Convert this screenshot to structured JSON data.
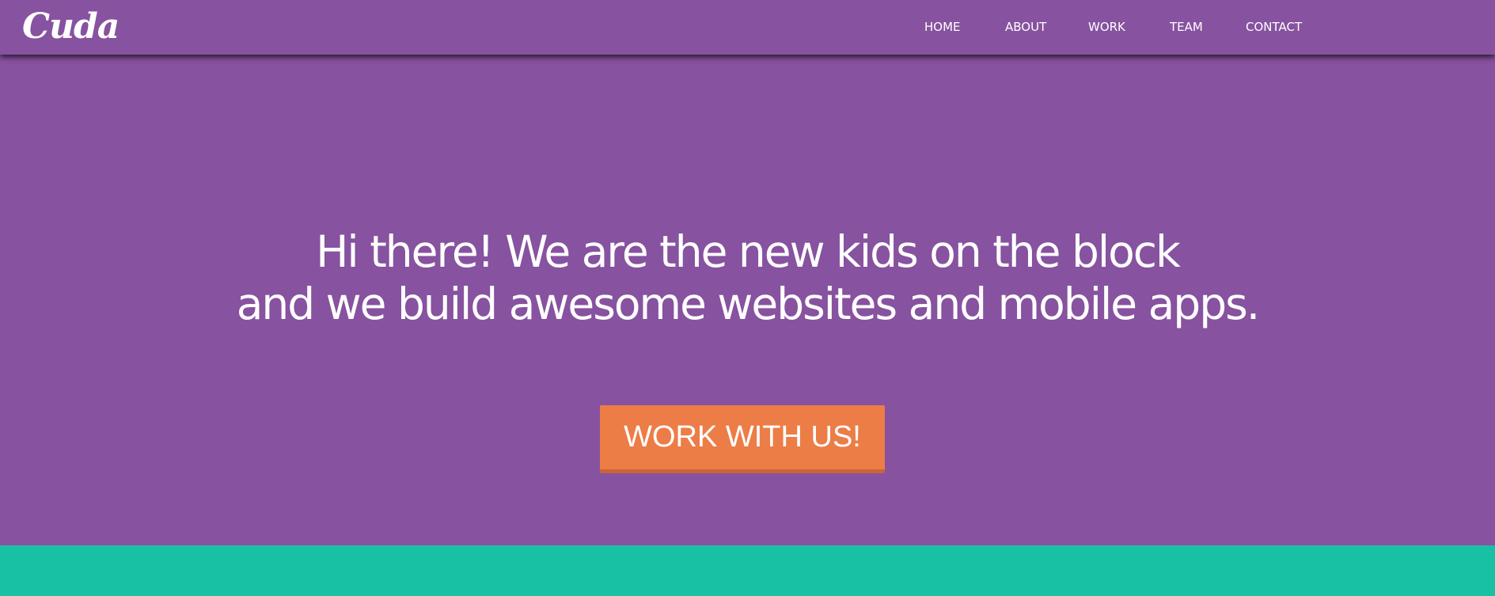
{
  "brand": {
    "logo_text": "Cuda"
  },
  "nav": {
    "items": [
      {
        "label": "HOME"
      },
      {
        "label": "ABOUT"
      },
      {
        "label": "WORK"
      },
      {
        "label": "TEAM"
      },
      {
        "label": "CONTACT"
      }
    ]
  },
  "hero": {
    "title_line_1": "Hi there! We are the new kids on the block",
    "title_line_2": "and we build awesome websites and mobile apps.",
    "cta_label": "WORK WITH US!"
  },
  "colors": {
    "primary_purple": "#8752a0",
    "accent_orange": "#ec7d47",
    "teal": "#18c1a4",
    "text": "#ffffff"
  }
}
